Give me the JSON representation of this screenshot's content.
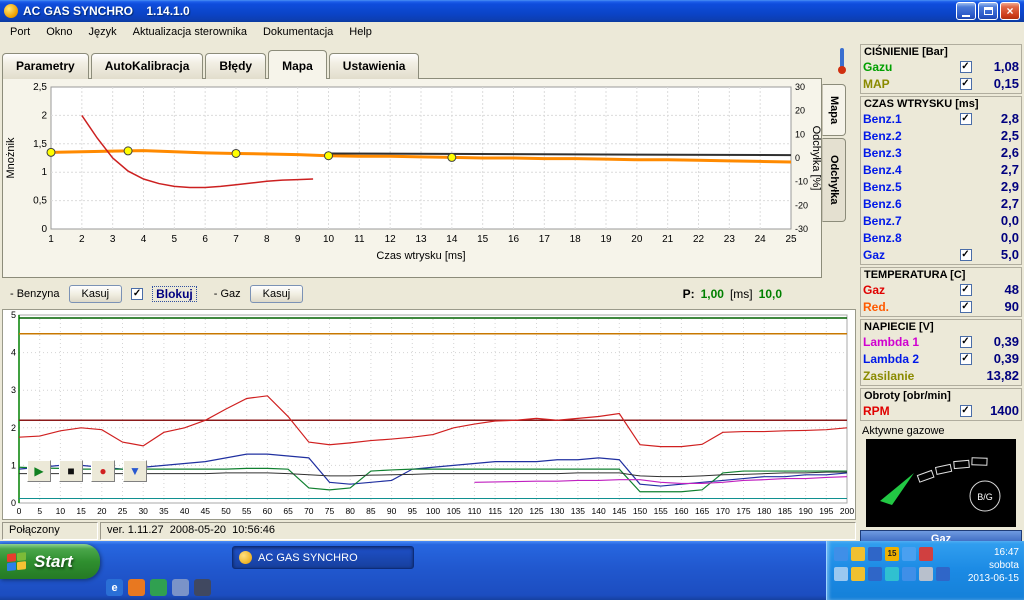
{
  "titlebar": {
    "title": "AC GAS SYNCHRO    1.14.1.0",
    "buttons": {
      "close": "×"
    }
  },
  "menubar": {
    "items": [
      "Port",
      "Okno",
      "Język",
      "Aktualizacja sterownika",
      "Dokumentacja",
      "Help"
    ]
  },
  "tabs": {
    "items": [
      "Parametry",
      "AutoKalibracja",
      "Błędy",
      "Mapa",
      "Ustawienia"
    ],
    "active": "Mapa"
  },
  "side_tabs": {
    "items": [
      "Mapa",
      "Odchyłka"
    ],
    "active": "Mapa"
  },
  "map_controls": {
    "benzyna_label": "- Benzyna",
    "kasuj_benzyna": "Kasuj",
    "blokuj_label": "Blokuj",
    "blokuj_checked": true,
    "gaz_label": "- Gaz",
    "kasuj_gaz": "Kasuj",
    "p_label": "P:",
    "p_value": "1,00",
    "p_unit": "[ms]",
    "p_value2": "10,0"
  },
  "scope_controls": {
    "buttons": [
      {
        "name": "play-button",
        "glyph": "▶",
        "color": "#108020"
      },
      {
        "name": "stop-button",
        "glyph": "■",
        "color": "#101010"
      },
      {
        "name": "record-button",
        "glyph": "●",
        "color": "#d02020"
      },
      {
        "name": "marker-button",
        "glyph": "▼",
        "color": "#2858d0"
      }
    ]
  },
  "status_bar": {
    "connection": "Połączony",
    "version": "ver. 1.11.27  2008-05-20  10:56:46"
  },
  "right_panel": {
    "values_color": "#00007e",
    "sections": [
      {
        "title": "CIŚNIENIE [Bar]",
        "rows": [
          {
            "label": "Gazu",
            "color": "#00a000",
            "checkbox": "checked",
            "value": "1,08"
          },
          {
            "label": "MAP",
            "color": "#8a8a00",
            "checkbox": "checked",
            "value": "0,15"
          }
        ]
      },
      {
        "title": "CZAS WTRYSKU [ms]",
        "rows": [
          {
            "label": "Benz.1",
            "color": "#0018e8",
            "checkbox": "checked",
            "value": "2,8"
          },
          {
            "label": "Benz.2",
            "color": "#0018e8",
            "checkbox": "none",
            "value": "2,5"
          },
          {
            "label": "Benz.3",
            "color": "#0018e8",
            "checkbox": "none",
            "value": "2,6"
          },
          {
            "label": "Benz.4",
            "color": "#0018e8",
            "checkbox": "none",
            "value": "2,7"
          },
          {
            "label": "Benz.5",
            "color": "#0018e8",
            "checkbox": "none",
            "value": "2,9"
          },
          {
            "label": "Benz.6",
            "color": "#0018e8",
            "checkbox": "none",
            "value": "2,7"
          },
          {
            "label": "Benz.7",
            "color": "#0018e8",
            "checkbox": "none",
            "value": "0,0"
          },
          {
            "label": "Benz.8",
            "color": "#0018e8",
            "checkbox": "none",
            "value": "0,0"
          },
          {
            "label": "Gaz",
            "color": "#0018e8",
            "checkbox": "checked",
            "value": "5,0"
          }
        ]
      },
      {
        "title": "TEMPERATURA [C]",
        "rows": [
          {
            "label": "Gaz",
            "color": "#e00000",
            "checkbox": "checked",
            "value": "48"
          },
          {
            "label": "Red.",
            "color": "#ff5a00",
            "checkbox": "checked",
            "value": "90"
          }
        ]
      },
      {
        "title": "NAPIECIE [V]",
        "rows": [
          {
            "label": "Lambda 1",
            "color": "#d000d0",
            "checkbox": "checked",
            "value": "0,39"
          },
          {
            "label": "Lambda 2",
            "color": "#0018e8",
            "checkbox": "checked",
            "value": "0,39"
          },
          {
            "label": "Zasilanie",
            "color": "#8a8a00",
            "checkbox": "none",
            "value": "13,82"
          }
        ]
      },
      {
        "title": "Obroty [obr/min]",
        "rows": [
          {
            "label": "RPM",
            "color": "#e00000",
            "checkbox": "checked",
            "value": "1400"
          }
        ]
      }
    ],
    "active_injectors_label": "Aktywne gazowe",
    "gauge": {
      "label": "B/G"
    },
    "fuel_mode": "Gaz"
  },
  "taskbar": {
    "start_label": "Start",
    "task_button": "AC GAS SYNCHRO",
    "quick_launch": [
      {
        "name": "quicklaunch-internet",
        "color": "#2a6fd6",
        "glyph": "e"
      },
      {
        "name": "quicklaunch-browser",
        "color": "#e87820",
        "glyph": ""
      },
      {
        "name": "quicklaunch-messenger",
        "color": "#30a050",
        "glyph": ""
      },
      {
        "name": "quicklaunch-show-desktop",
        "color": "#7a93c8",
        "glyph": ""
      },
      {
        "name": "quicklaunch-media-player",
        "color": "#404860",
        "glyph": ""
      }
    ],
    "tray_rows": [
      [
        {
          "name": "tray-icon-network",
          "color": "#3f8fe8"
        },
        {
          "name": "tray-icon-update",
          "color": "#f0c030"
        },
        {
          "name": "tray-icon-security",
          "color": "#2f66c8"
        },
        {
          "name": "tray-icon-calendar",
          "color": "#f0b000",
          "glyph": "15"
        },
        {
          "name": "tray-icon-volume",
          "color": "#4aa0f0"
        },
        {
          "name": "tray-icon-alert",
          "color": "#d04040"
        }
      ],
      [
        {
          "name": "tray-icon-messenger",
          "color": "#9ac8f0"
        },
        {
          "name": "tray-icon-energy",
          "color": "#f0c030"
        },
        {
          "name": "tray-icon-display",
          "color": "#2f66c8"
        },
        {
          "name": "tray-icon-usb",
          "color": "#30c0d0"
        },
        {
          "name": "tray-icon-sync",
          "color": "#3f8fe8"
        },
        {
          "name": "tray-icon-printer",
          "color": "#b8c0cc"
        },
        {
          "name": "tray-icon-lan",
          "color": "#2f66c8"
        }
      ]
    ],
    "clock": {
      "time": "16:47",
      "day": "sobota",
      "date": "2013-06-15"
    }
  },
  "chart_data": [
    {
      "type": "line",
      "title": "",
      "xlabel": "Czas wtrysku [ms]",
      "ylabel_left": "Mnożnik",
      "ylabel_right": "Odchyłka [%]",
      "xlim": [
        1,
        25
      ],
      "ylim_left": [
        0,
        2.5
      ],
      "ylim_right": [
        -30,
        30
      ],
      "x_ticks": [
        1,
        2,
        3,
        4,
        5,
        6,
        7,
        8,
        9,
        10,
        11,
        12,
        13,
        14,
        15,
        16,
        17,
        18,
        19,
        20,
        21,
        22,
        23,
        24,
        25
      ],
      "y_ticks_left": [
        0,
        0.5,
        1,
        1.5,
        2,
        2.5
      ],
      "y_tick_labels_left": [
        "0",
        "0,5",
        "1",
        "1,5",
        "2",
        "2,5"
      ],
      "y_ticks_right": [
        30,
        20,
        10,
        0,
        -10,
        -20,
        -30
      ],
      "grid": true,
      "series": [
        {
          "name": "multiplier-map-line",
          "color": "#ff8a00",
          "width": 3,
          "x_start": 1,
          "x_step": 1,
          "y": [
            1.35,
            1.36,
            1.37,
            1.38,
            1.36,
            1.34,
            1.33,
            1.32,
            1.31,
            1.29,
            1.28,
            1.28,
            1.27,
            1.26,
            1.25,
            1.25,
            1.24,
            1.24,
            1.23,
            1.22,
            1.22,
            1.21,
            1.2,
            1.19,
            1.18
          ]
        },
        {
          "name": "deviation-line",
          "color": "#cc2020",
          "width": 1.5,
          "x": [
            2,
            2.5,
            3,
            3.5,
            4,
            4.5,
            5,
            5.5,
            6,
            6.5,
            7,
            7.5,
            8,
            8.5,
            9,
            9.5
          ],
          "y": [
            2.0,
            1.6,
            1.25,
            1.02,
            0.88,
            0.8,
            0.75,
            0.73,
            0.73,
            0.75,
            0.78,
            0.81,
            0.84,
            0.86,
            0.87,
            0.88
          ]
        },
        {
          "name": "reference-line",
          "color": "#303030",
          "width": 2,
          "x": [
            10,
            25
          ],
          "y": [
            1.33,
            1.3
          ]
        }
      ],
      "map_points": {
        "name": "map-node-points",
        "color": "#ffff00",
        "x": [
          1,
          3.5,
          7,
          10,
          14
        ],
        "y": [
          1.35,
          1.375,
          1.33,
          1.29,
          1.26
        ]
      }
    },
    {
      "type": "line",
      "title": "",
      "xlabel": "",
      "ylabel": "",
      "xlim": [
        0,
        200
      ],
      "ylim": [
        0,
        5
      ],
      "x_tick_step": 5,
      "y_ticks": [
        0,
        1,
        2,
        3,
        4,
        5
      ],
      "grid": true,
      "series": [
        {
          "name": "signal-green-top",
          "color": "#006000",
          "width": 1.5,
          "x": [
            0,
            200
          ],
          "y": [
            4.92,
            4.92
          ]
        },
        {
          "name": "signal-orange",
          "color": "#c87800",
          "width": 1.5,
          "x": [
            0,
            200
          ],
          "y": [
            4.5,
            4.5
          ]
        },
        {
          "name": "signal-darkred",
          "color": "#8b1a1a",
          "width": 1.5,
          "x": [
            0,
            200
          ],
          "y": [
            2.2,
            2.2
          ]
        },
        {
          "name": "signal-red",
          "color": "#d02020",
          "width": 1.2,
          "x_start": 0,
          "x_step": 5,
          "y": [
            1.75,
            1.78,
            1.92,
            2.0,
            1.95,
            1.62,
            1.52,
            1.88,
            2.0,
            2.2,
            2.5,
            2.78,
            2.85,
            2.3,
            1.62,
            1.55,
            1.6,
            1.66,
            1.7,
            1.75,
            1.82,
            2.0,
            2.1,
            2.18,
            2.2,
            2.25,
            2.2,
            2.25,
            2.3,
            2.38,
            1.55,
            1.5,
            1.5,
            1.56,
            1.88,
            1.9,
            1.9,
            1.92,
            1.93,
            1.95,
            2.0
          ]
        },
        {
          "name": "signal-blue",
          "color": "#2030a0",
          "width": 1.2,
          "x_start": 0,
          "x_step": 5,
          "y": [
            0.9,
            0.95,
            1.0,
            1.0,
            0.95,
            0.9,
            0.95,
            1.0,
            1.05,
            1.1,
            1.2,
            1.3,
            1.3,
            1.25,
            1.2,
            0.55,
            0.5,
            0.55,
            0.6,
            0.9,
            0.95,
            1.0,
            1.05,
            1.1,
            1.1,
            1.1,
            1.15,
            1.15,
            1.2,
            1.15,
            0.5,
            0.45,
            0.5,
            0.55,
            0.6,
            0.65,
            0.7,
            0.7,
            0.75,
            0.75,
            0.8
          ]
        },
        {
          "name": "signal-green",
          "color": "#108030",
          "width": 1.2,
          "x_start": 0,
          "x_step": 5,
          "y": [
            0.95,
            0.93,
            0.92,
            0.9,
            0.9,
            0.9,
            0.9,
            0.9,
            0.9,
            0.9,
            0.9,
            0.92,
            0.92,
            0.9,
            0.4,
            0.35,
            0.4,
            0.85,
            0.88,
            0.9,
            0.9,
            0.9,
            0.9,
            0.9,
            0.9,
            0.9,
            0.9,
            0.9,
            0.9,
            0.9,
            0.3,
            0.3,
            0.3,
            0.35,
            0.8,
            0.85,
            0.85,
            0.85,
            0.85,
            0.85,
            0.85
          ]
        },
        {
          "name": "signal-black",
          "color": "#303030",
          "width": 1,
          "x_start": 0,
          "x_step": 5,
          "y": [
            0.78,
            0.78,
            0.78,
            0.78,
            0.78,
            0.78,
            0.78,
            0.78,
            0.78,
            0.78,
            0.8,
            0.8,
            0.8,
            0.78,
            0.75,
            0.72,
            0.72,
            0.74,
            0.75,
            0.76,
            0.78,
            0.78,
            0.78,
            0.78,
            0.78,
            0.78,
            0.78,
            0.8,
            0.8,
            0.8,
            0.72,
            0.7,
            0.7,
            0.72,
            0.75,
            0.76,
            0.78,
            0.8,
            0.8,
            0.82,
            0.82
          ]
        },
        {
          "name": "signal-magenta",
          "color": "#c020c0",
          "width": 1.2,
          "x_start": 110,
          "x_step": 5,
          "y": [
            0.55,
            0.56,
            0.57,
            0.58,
            0.58,
            0.6,
            0.6,
            0.62,
            0.62,
            0.55,
            0.52,
            0.52,
            0.55,
            0.6,
            0.62,
            0.65,
            0.65,
            0.68,
            0.7
          ]
        },
        {
          "name": "signal-teal",
          "color": "#109090",
          "width": 1,
          "x": [
            0,
            200
          ],
          "y": [
            0.12,
            0.12
          ]
        }
      ]
    }
  ]
}
